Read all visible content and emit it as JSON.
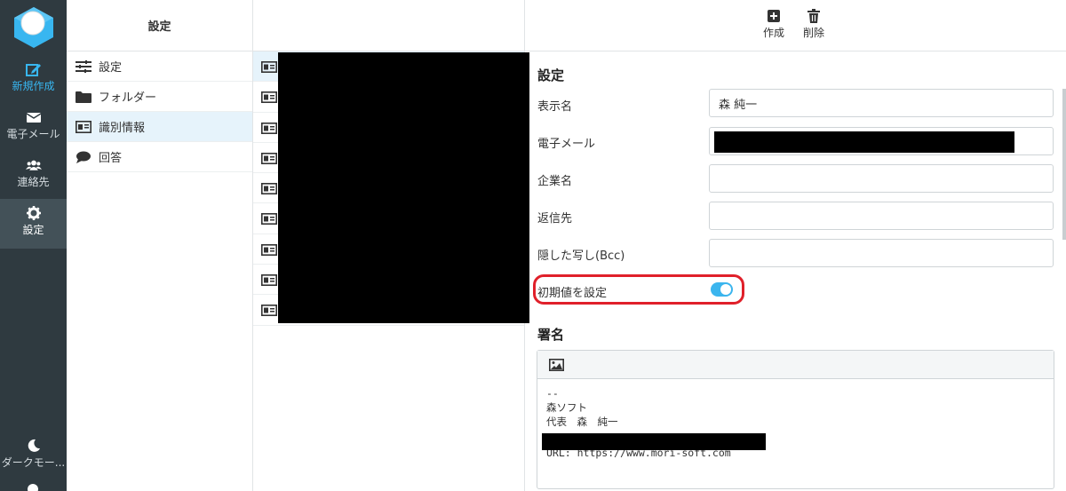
{
  "nav": {
    "items": [
      {
        "label": "新規作成",
        "icon": "compose-icon"
      },
      {
        "label": "電子メール",
        "icon": "envelope-icon"
      },
      {
        "label": "連絡先",
        "icon": "contacts-icon"
      },
      {
        "label": "設定",
        "icon": "gear-icon"
      },
      {
        "label": "ダークモー...",
        "icon": "moon-icon"
      }
    ]
  },
  "settings": {
    "header": "設定",
    "menu": [
      {
        "label": "設定",
        "icon": "sliders-icon"
      },
      {
        "label": "フォルダー",
        "icon": "folder-icon"
      },
      {
        "label": "識別情報",
        "icon": "id-card-icon"
      },
      {
        "label": "回答",
        "icon": "speech-bubble-icon"
      }
    ]
  },
  "toolbar": {
    "create_label": "作成",
    "delete_label": "削除"
  },
  "form": {
    "section_title": "設定",
    "display_name_label": "表示名",
    "display_name_value": "森 純一",
    "email_label": "電子メール",
    "company_label": "企業名",
    "reply_to_label": "返信先",
    "bcc_label": "隠した写し(Bcc)",
    "default_label": "初期値を設定",
    "default_on": true,
    "signature_title": "署名",
    "signature_lines": {
      "sep": "--",
      "company": "森ソフト",
      "rep": "代表　森　純一",
      "url": "URL: https://www.mori-soft.com"
    }
  },
  "colors": {
    "nav_bg": "#2f3a40",
    "accent": "#38b6f0",
    "highlight": "#e0202a",
    "selected_row": "#e6f3fb"
  }
}
